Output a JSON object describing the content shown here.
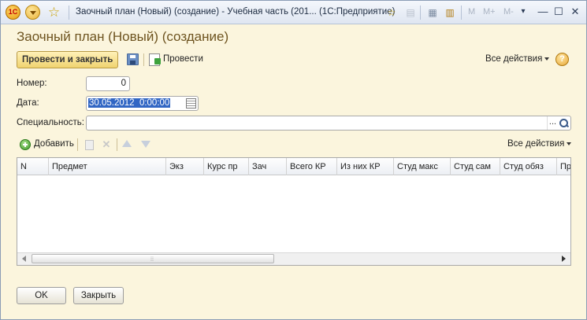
{
  "window": {
    "title": "Заочный план (Новый) (создание) - Учебная часть (201... (1С:Предприятие)",
    "toolbar_m_labels": [
      "M",
      "M+",
      "M-"
    ]
  },
  "form": {
    "title": "Заочный план (Новый) (создание)"
  },
  "command_bar": {
    "post_and_close_label": "Провести и закрыть",
    "post_label": "Провести",
    "all_actions_label": "Все действия",
    "help_label": "?"
  },
  "fields": {
    "number": {
      "label": "Номер:",
      "value": "0"
    },
    "date": {
      "label": "Дата:",
      "value": "30.05.2012  0:00:00"
    },
    "specialty": {
      "label": "Специальность:",
      "value": "",
      "select_label": "..."
    }
  },
  "table_bar": {
    "add_label": "Добавить",
    "all_actions_label": "Все действия"
  },
  "table": {
    "columns": [
      "N",
      "Предмет",
      "Экз",
      "Курс пр",
      "Зач",
      "Всего КР",
      "Из них КР",
      "Студ макс",
      "Студ сам",
      "Студ обяз",
      "Пр"
    ],
    "rows": []
  },
  "buttons": {
    "ok_label": "OK",
    "close_label": "Закрыть"
  },
  "colors": {
    "form_background": "#fbf5dd",
    "form_title": "#6e5420",
    "primary_button": "#f0d36f",
    "date_selection": "#3166c4"
  }
}
